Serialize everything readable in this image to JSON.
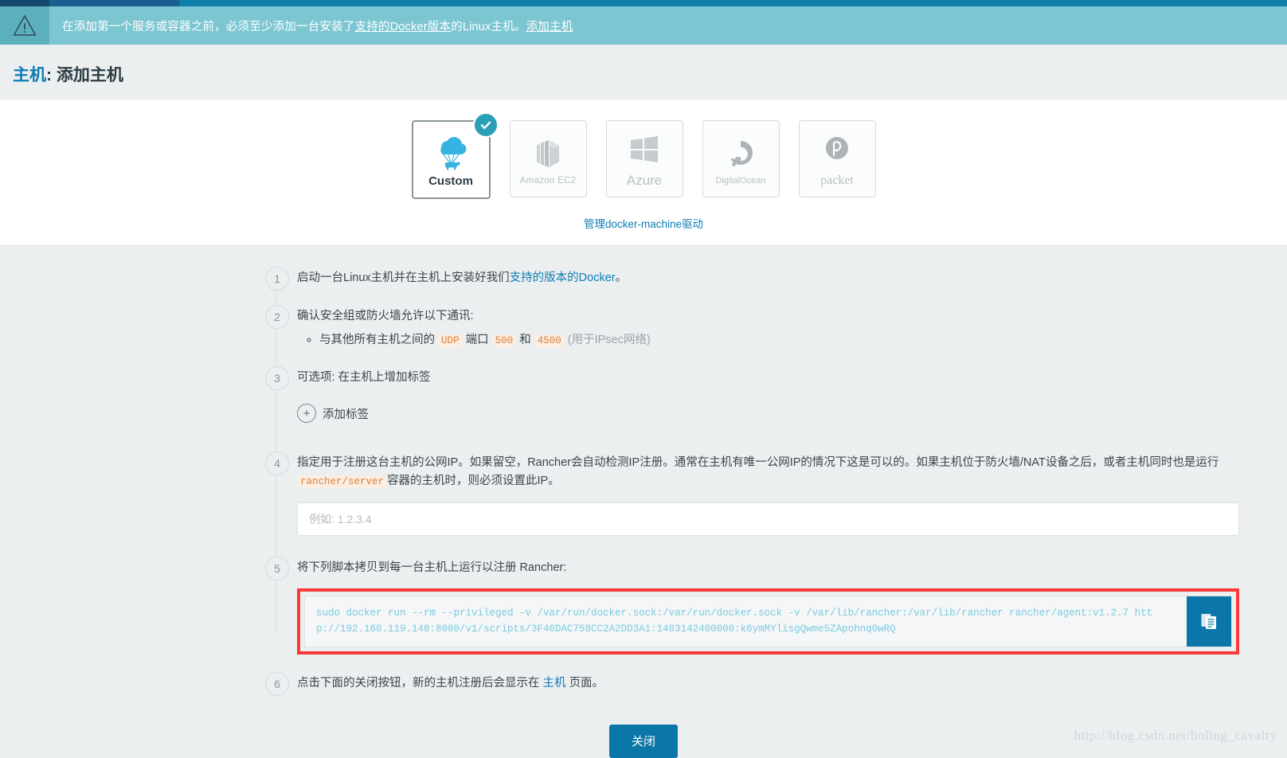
{
  "banner": {
    "icon": "warning-triangle-icon",
    "text_before": "在添加第一个服务或容器之前，必须至少添加一台安装了",
    "link_docker_version": "支持的Docker版本",
    "text_middle": "的Linux主机。",
    "link_add_host": "添加主机"
  },
  "header": {
    "title_link": "主机",
    "title_rest": ": 添加主机"
  },
  "drivers": {
    "selected": "Custom",
    "cards": [
      {
        "id": "custom",
        "label": "Custom",
        "icon": "cloud-parachute-cow-icon",
        "selected": true
      },
      {
        "id": "amazon-ec2",
        "label": "Amazon EC2",
        "icon": "amazon-ec2-icon",
        "selected": false
      },
      {
        "id": "azure",
        "label": "Azure",
        "icon": "azure-icon",
        "selected": false
      },
      {
        "id": "digitalocean",
        "label": "DigitalOcean",
        "icon": "digitalocean-icon",
        "selected": false
      },
      {
        "id": "packet",
        "label": "packet",
        "icon": "packet-icon",
        "selected": false
      }
    ],
    "manage_link": "管理docker-machine驱动",
    "check_badge": "check-icon"
  },
  "steps": [
    {
      "num": "1",
      "text_before": "启动一台Linux主机并在主机上安装好我们",
      "link": "支持的版本的Docker",
      "text_after": "。"
    },
    {
      "num": "2",
      "text": "确认安全组或防火墙允许以下通讯:",
      "bullet": {
        "before": "与其他所有主机之间的",
        "code_udp": "UDP",
        "mid1": "端口",
        "code_500": "500",
        "mid2": "和",
        "code_4500": "4500",
        "after": "(用于IPsec网络)"
      }
    },
    {
      "num": "3",
      "text": "可选项: 在主机上增加标签",
      "add_label_button": "添加标签",
      "add_label_icon": "plus-circle-icon"
    },
    {
      "num": "4",
      "text_before": "指定用于注册这台主机的公网IP。如果留空，Rancher会自动检测IP注册。通常在主机有唯一公网IP的情况下这是可以的。如果主机位于防火墙/NAT设备之后，或者主机同时也是运行",
      "code": "rancher/server",
      "text_after": "容器的主机时，则必须设置此IP。",
      "input_value": "",
      "input_placeholder": "例如: 1.2.3.4"
    },
    {
      "num": "5",
      "text": "将下列脚本拷贝到每一台主机上运行以注册 Rancher:",
      "command": "sudo docker run --rm --privileged -v /var/run/docker.sock:/var/run/docker.sock -v /var/lib/rancher:/var/lib/rancher rancher/agent:v1.2.7 http://192.168.119.148:8080/v1/scripts/3F46DAC758CC2A2DD3A1:1483142400000:k6ymMYlisgQwme5ZApohnq0wRQ",
      "copy_icon": "clipboard-copy-icon",
      "highlight_color": "#f93a37"
    },
    {
      "num": "6",
      "text_before": "点击下面的关闭按钮，新的主机注册后会显示在",
      "link": "主机",
      "text_after": "页面。"
    }
  ],
  "footer": {
    "close_button": "关闭"
  },
  "watermark": "http://blog.csdn.net/boling_cavalry",
  "colors": {
    "banner_bg": "#7cc6d2",
    "banner_icon_bg": "#5cafbd",
    "accent_blue": "#0b76a8",
    "link_blue": "#0c7bb3",
    "highlight_red": "#f93a37",
    "check_teal": "#2a9fb7",
    "code_orange": "#d9813c",
    "command_text": "#7ccbe0"
  }
}
